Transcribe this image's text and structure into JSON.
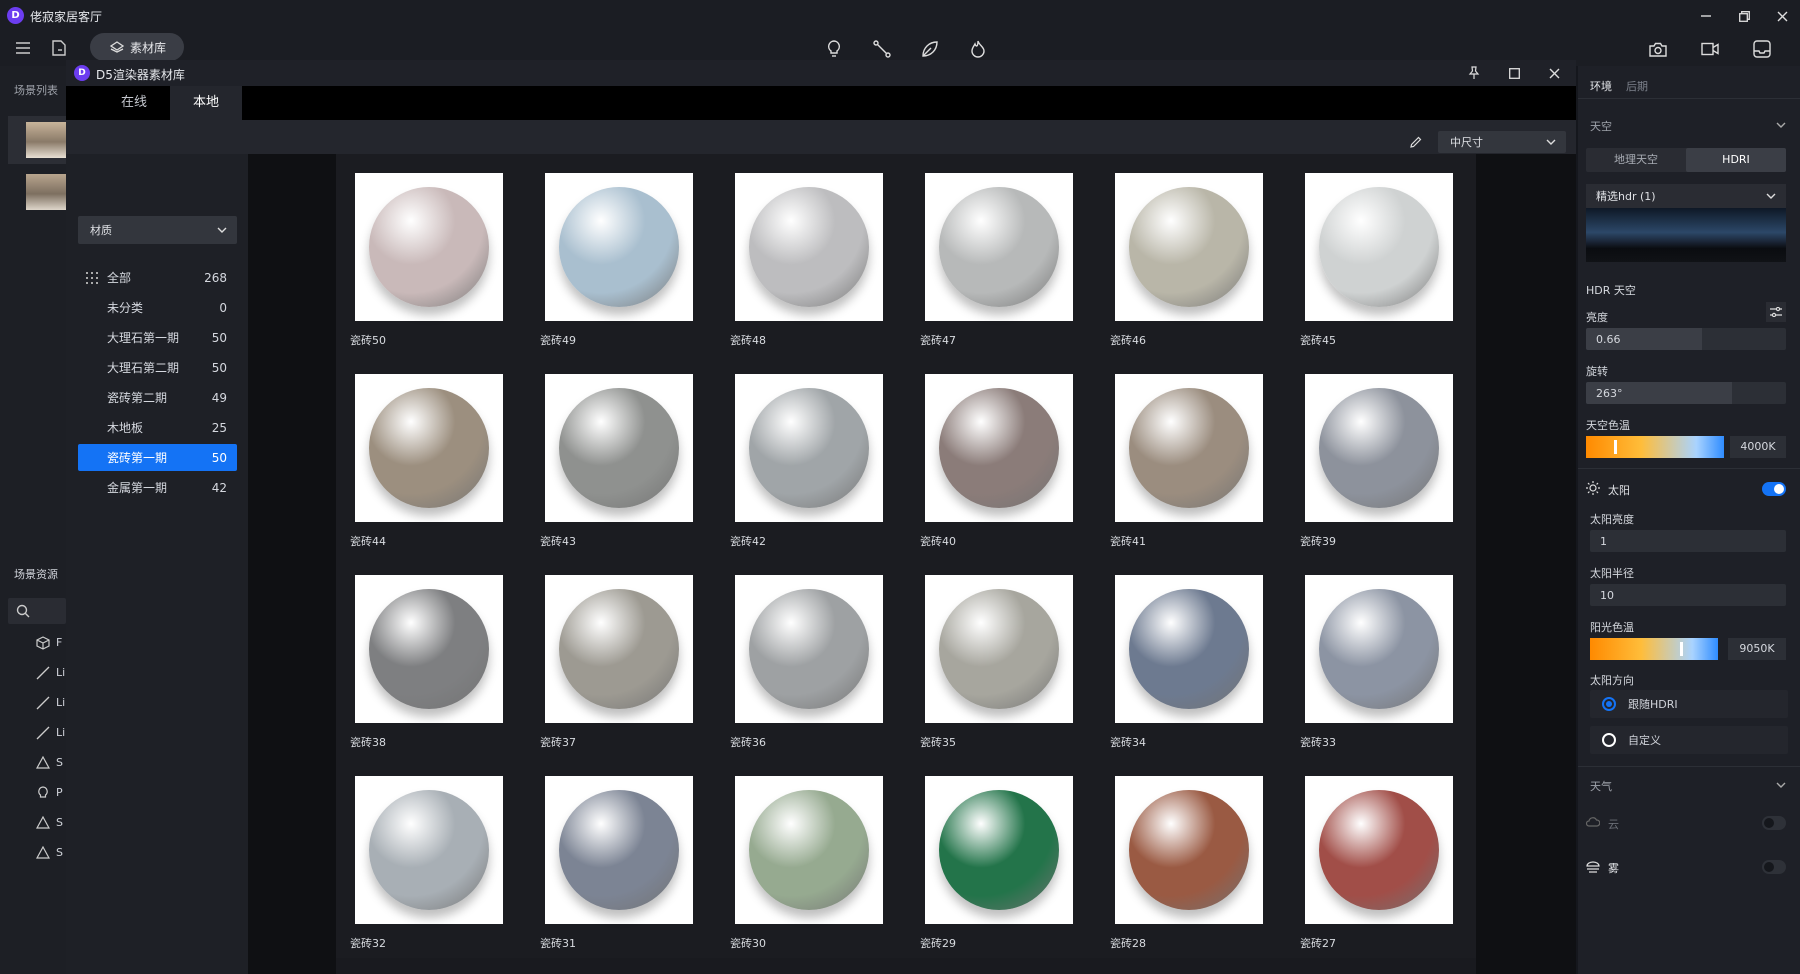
{
  "app": {
    "title": "佬寂家居客厅",
    "material_library_button": "素材库"
  },
  "scene_panel": {
    "scene_list_label": "场景列表",
    "scene_resources_label": "场景资源",
    "resource_items": [
      {
        "icon": "cube-icon",
        "label": "F"
      },
      {
        "icon": "line-icon",
        "label": "Li"
      },
      {
        "icon": "line-icon",
        "label": "Li"
      },
      {
        "icon": "line-icon",
        "label": "Li"
      },
      {
        "icon": "spot-icon",
        "label": "S"
      },
      {
        "icon": "bulb-icon",
        "label": "P"
      },
      {
        "icon": "spot-icon",
        "label": "S"
      },
      {
        "icon": "spot-icon",
        "label": "S"
      }
    ]
  },
  "library": {
    "title": "D5渲染器素材库",
    "tabs": [
      {
        "label": "在线",
        "active": false
      },
      {
        "label": "本地",
        "active": true
      }
    ],
    "size_select": "中尺寸",
    "category_select": "材质",
    "categories": [
      {
        "label": "全部",
        "count": "268",
        "active": false
      },
      {
        "label": "未分类",
        "count": "0",
        "active": false
      },
      {
        "label": "大理石第一期",
        "count": "50",
        "active": false
      },
      {
        "label": "大理石第二期",
        "count": "50",
        "active": false
      },
      {
        "label": "瓷砖第二期",
        "count": "49",
        "active": false
      },
      {
        "label": "木地板",
        "count": "25",
        "active": false
      },
      {
        "label": "瓷砖第一期",
        "count": "50",
        "active": true
      },
      {
        "label": "金属第一期",
        "count": "42",
        "active": false
      }
    ],
    "materials": [
      {
        "name": "瓷砖50",
        "color": "#c9b9b9"
      },
      {
        "name": "瓷砖49",
        "color": "#a9bfcf"
      },
      {
        "name": "瓷砖48",
        "color": "#bdbdbf"
      },
      {
        "name": "瓷砖47",
        "color": "#b7b9b9"
      },
      {
        "name": "瓷砖46",
        "color": "#b9b6a8"
      },
      {
        "name": "瓷砖45",
        "color": "#cfd2d2"
      },
      {
        "name": "瓷砖44",
        "color": "#9c8f7f"
      },
      {
        "name": "瓷砖43",
        "color": "#8f918f"
      },
      {
        "name": "瓷砖42",
        "color": "#a0a5a8"
      },
      {
        "name": "瓷砖40",
        "color": "#8b7c79"
      },
      {
        "name": "瓷砖41",
        "color": "#9b8d7f"
      },
      {
        "name": "瓷砖39",
        "color": "#8d929c"
      },
      {
        "name": "瓷砖38",
        "color": "#7e7f81"
      },
      {
        "name": "瓷砖37",
        "color": "#9d9a92"
      },
      {
        "name": "瓷砖36",
        "color": "#9ea1a3"
      },
      {
        "name": "瓷砖35",
        "color": "#a7a69e"
      },
      {
        "name": "瓷砖34",
        "color": "#6d7a90"
      },
      {
        "name": "瓷砖33",
        "color": "#8c94a3"
      },
      {
        "name": "瓷砖32",
        "color": "#a8afb5"
      },
      {
        "name": "瓷砖31",
        "color": "#7c8494"
      },
      {
        "name": "瓷砖30",
        "color": "#96aa90"
      },
      {
        "name": "瓷砖29",
        "color": "#23744a"
      },
      {
        "name": "瓷砖28",
        "color": "#9a5a43"
      },
      {
        "name": "瓷砖27",
        "color": "#a14e48"
      }
    ]
  },
  "env_panel": {
    "tabs": [
      {
        "label": "环境",
        "active": true
      },
      {
        "label": "后期",
        "active": false
      }
    ],
    "sky_section": "天空",
    "sky_modes": [
      {
        "label": "地理天空",
        "active": false
      },
      {
        "label": "HDRI",
        "active": true
      }
    ],
    "hdr_select": "精选hdr (1)",
    "hdr_sky_label": "HDR 天空",
    "brightness_label": "亮度",
    "brightness_value": "0.66",
    "brightness_fraction": 0.58,
    "rotation_label": "旋转",
    "rotation_value": "263°",
    "rotation_fraction": 0.73,
    "sky_color_temp_label": "天空色温",
    "sky_color_temp_value": "4000K",
    "sky_color_temp_fraction": 0.2,
    "sun_label": "太阳",
    "sun_enabled": true,
    "sun_brightness_label": "太阳亮度",
    "sun_brightness_value": "1",
    "sun_radius_label": "太阳半径",
    "sun_radius_value": "10",
    "sun_color_temp_label": "阳光色温",
    "sun_color_temp_value": "9050K",
    "sun_color_temp_fraction": 0.7,
    "sun_direction_label": "太阳方向",
    "sun_direction_options": [
      {
        "label": "跟随HDRI",
        "selected": true
      },
      {
        "label": "自定义",
        "selected": false
      }
    ],
    "weather_section": "天气",
    "cloud_label": "云",
    "cloud_enabled": false,
    "fog_label": "雾",
    "fog_enabled": false
  },
  "colors": {
    "accent": "#1473f5",
    "panel_bg": "#1e2027",
    "window_bg": "#15171d"
  }
}
